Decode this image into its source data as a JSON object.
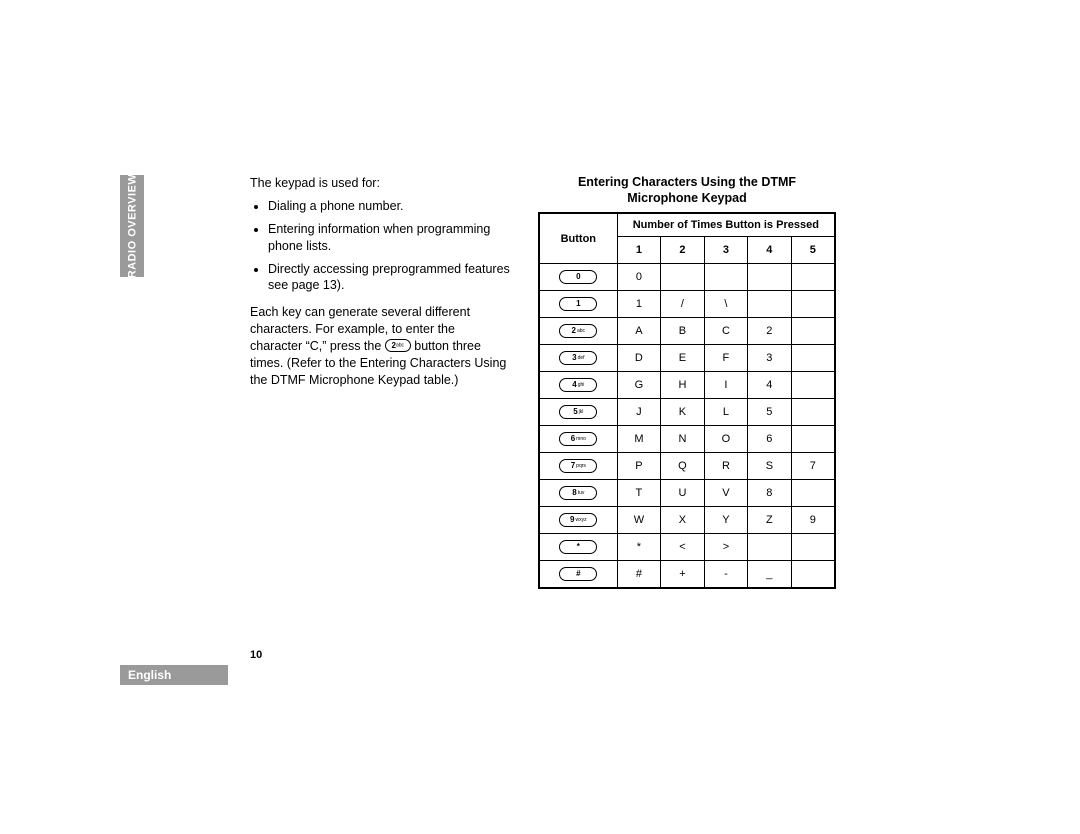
{
  "sidebar": {
    "section_label": "RADIO OVERVIEW"
  },
  "left": {
    "intro": "The keypad is used for:",
    "bullets": [
      "Dialing a phone number.",
      "Entering information when programming phone lists.",
      "Directly accessing preprogrammed features see page 13)."
    ],
    "para_before_key": "Each key can generate several different characters. For example, to enter the character “C,” press the ",
    "inline_key": {
      "digit": "2",
      "letters": "abc"
    },
    "para_after_key": " button three times. (Refer to the Entering Characters Using the DTMF Microphone Keypad table.)"
  },
  "table": {
    "title_line1": "Entering Characters Using the DTMF",
    "title_line2": "Microphone Keypad",
    "header_span": "Number of Times Button is Pressed",
    "col_button": "Button",
    "cols": [
      "1",
      "2",
      "3",
      "4",
      "5"
    ],
    "rows": [
      {
        "key": {
          "digit": "0",
          "letters": ""
        },
        "v": [
          "0",
          "",
          "",
          "",
          ""
        ]
      },
      {
        "key": {
          "digit": "1",
          "letters": ""
        },
        "v": [
          "1",
          "/",
          "\\",
          "",
          ""
        ]
      },
      {
        "key": {
          "digit": "2",
          "letters": "abc"
        },
        "v": [
          "A",
          "B",
          "C",
          "2",
          ""
        ]
      },
      {
        "key": {
          "digit": "3",
          "letters": "def"
        },
        "v": [
          "D",
          "E",
          "F",
          "3",
          ""
        ]
      },
      {
        "key": {
          "digit": "4",
          "letters": "ghi"
        },
        "v": [
          "G",
          "H",
          "I",
          "4",
          ""
        ]
      },
      {
        "key": {
          "digit": "5",
          "letters": "jkl"
        },
        "v": [
          "J",
          "K",
          "L",
          "5",
          ""
        ]
      },
      {
        "key": {
          "digit": "6",
          "letters": "mno"
        },
        "v": [
          "M",
          "N",
          "O",
          "6",
          ""
        ]
      },
      {
        "key": {
          "digit": "7",
          "letters": "pqrs"
        },
        "v": [
          "P",
          "Q",
          "R",
          "S",
          "7"
        ]
      },
      {
        "key": {
          "digit": "8",
          "letters": "tuv"
        },
        "v": [
          "T",
          "U",
          "V",
          "8",
          ""
        ]
      },
      {
        "key": {
          "digit": "9",
          "letters": "wxyz"
        },
        "v": [
          "W",
          "X",
          "Y",
          "Z",
          "9"
        ]
      },
      {
        "key": {
          "digit": "*",
          "letters": ""
        },
        "v": [
          "*",
          "<",
          ">",
          "",
          ""
        ]
      },
      {
        "key": {
          "digit": "#",
          "letters": ""
        },
        "v": [
          "#",
          "+",
          "-",
          "_",
          ""
        ]
      }
    ]
  },
  "footer": {
    "page_number": "10",
    "language": "English"
  }
}
